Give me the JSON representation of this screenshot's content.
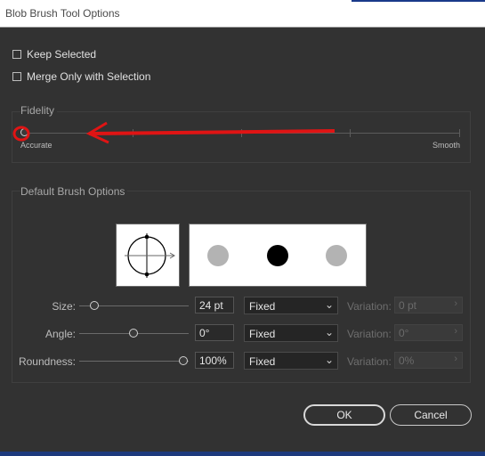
{
  "window": {
    "title": "Blob Brush Tool Options"
  },
  "options": {
    "keep_selected": {
      "label": "Keep Selected",
      "checked": false
    },
    "merge_only": {
      "label": "Merge Only with Selection",
      "checked": false
    }
  },
  "fidelity": {
    "label": "Fidelity",
    "min_label": "Accurate",
    "max_label": "Smooth",
    "level": 0
  },
  "brush": {
    "label": "Default Brush Options",
    "size": {
      "label": "Size:",
      "value": "24 pt",
      "mode": "Fixed",
      "variation_label": "Variation:",
      "variation_value": "0 pt",
      "level": 0.15
    },
    "angle": {
      "label": "Angle:",
      "value": "0°",
      "mode": "Fixed",
      "variation_label": "Variation:",
      "variation_value": "0°",
      "level": 0.5
    },
    "roundness": {
      "label": "Roundness:",
      "value": "100%",
      "mode": "Fixed",
      "variation_label": "Variation:",
      "variation_value": "0%",
      "level": 1.0
    }
  },
  "buttons": {
    "ok": "OK",
    "cancel": "Cancel"
  },
  "annotation": {
    "color": "#e01414"
  }
}
